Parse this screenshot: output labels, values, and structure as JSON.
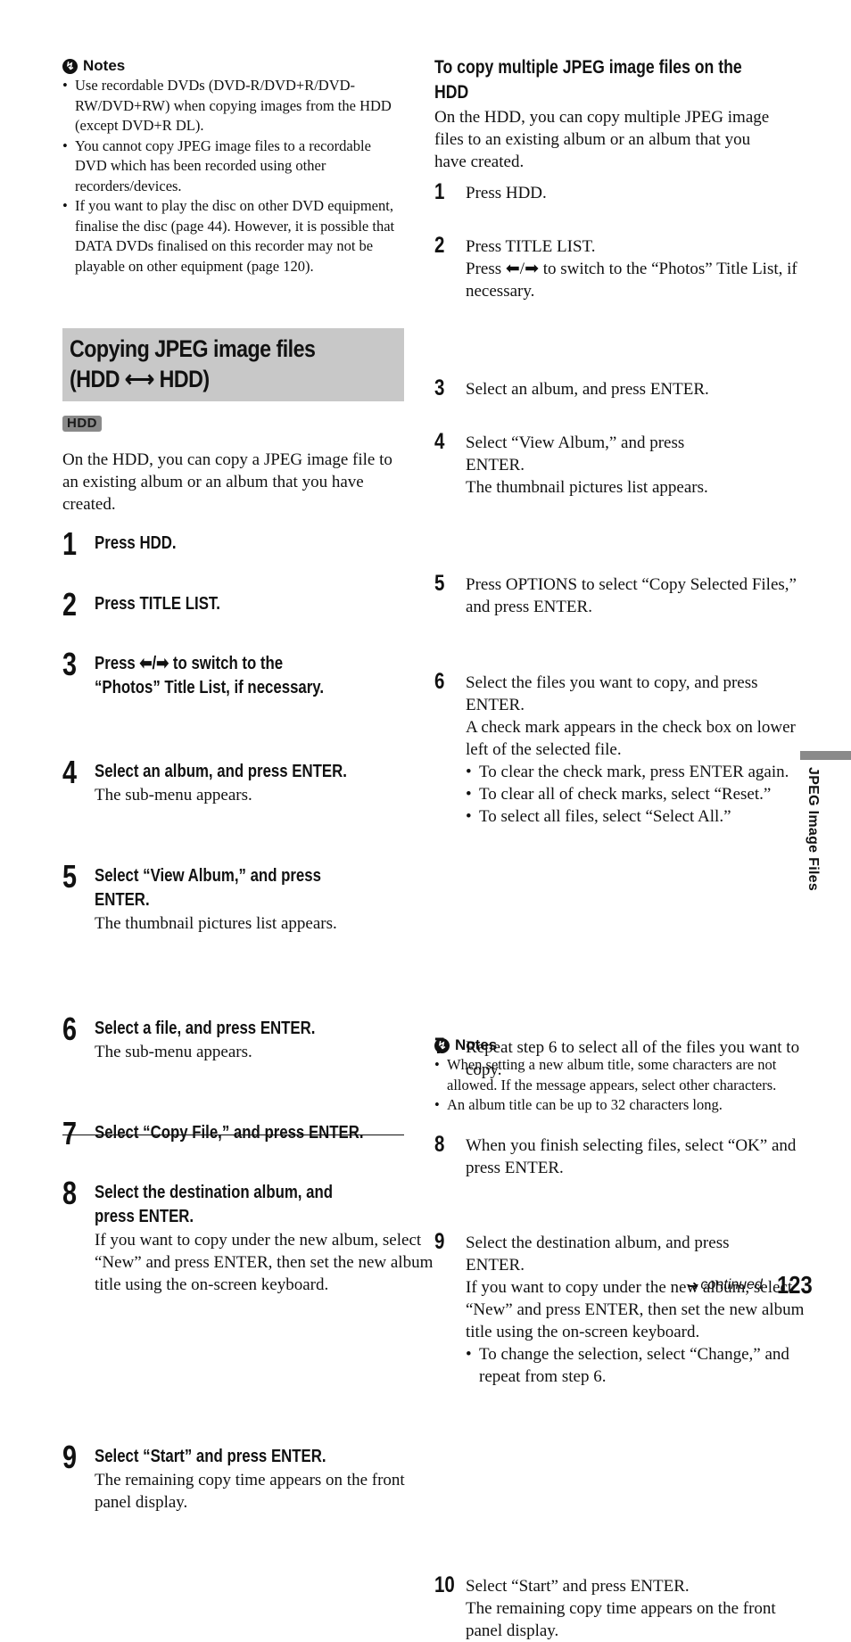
{
  "left": {
    "notes": {
      "heading": "Notes",
      "items": [
        "Use recordable DVDs (DVD-R/DVD+R/DVD-RW/DVD+RW) when copying images from the HDD (except DVD+R DL).",
        "You cannot copy JPEG image files to a recordable DVD which has been recorded using other recorders/devices.",
        "If you want to play the disc on other DVD equipment, finalise the disc (page 44). However, it is possible that DATA DVDs finalised on this recorder may not be playable on other equipment (page 120)."
      ]
    },
    "section_title_line1": "Copying JPEG image files",
    "section_title_line2": "(HDD ⟷ HDD)",
    "badge": "HDD",
    "intro": "On the HDD, you can copy a JPEG image file to an existing album or an album that you have created.",
    "steps": [
      {
        "num": "1",
        "title": "Press HDD.",
        "sub": ""
      },
      {
        "num": "2",
        "title": "Press TITLE LIST.",
        "sub": ""
      },
      {
        "num": "3",
        "title": "Press ⬅/➡ to switch to the",
        "title2": "“Photos” Title List, if necessary.",
        "sub": ""
      },
      {
        "num": "4",
        "title": "Select an album, and press ENTER.",
        "sub": "The sub-menu appears."
      },
      {
        "num": "5",
        "title": "Select “View Album,” and press",
        "title2": "ENTER.",
        "sub": "The thumbnail pictures list appears."
      },
      {
        "num": "6",
        "title": "Select a file, and press ENTER.",
        "sub": "The sub-menu appears."
      },
      {
        "num": "7",
        "title": "Select “Copy File,” and press ENTER.",
        "sub": ""
      },
      {
        "num": "8",
        "title": "Select the destination album, and",
        "title2": "press ENTER.",
        "sub": "If you want to copy under the new album, select “New” and press ENTER, then set the new album title using the on-screen keyboard."
      },
      {
        "num": "9",
        "title": "Select “Start” and press ENTER.",
        "sub": "The remaining copy time appears on the front panel display."
      }
    ]
  },
  "right": {
    "heading_line1": "To copy multiple JPEG image files on the",
    "heading_line2": "HDD",
    "intro": "On the HDD, you can copy multiple JPEG image files to an existing album or an album that you have created.",
    "steps": [
      {
        "num": "1",
        "text": "Press HDD."
      },
      {
        "num": "2",
        "text": "Press TITLE LIST.",
        "text2": "Press ⬅/➡ to switch to the “Photos” Title List, if necessary."
      },
      {
        "num": "3",
        "text": "Select an album, and press ENTER."
      },
      {
        "num": "4",
        "text": "Select “View Album,” and press ENTER.",
        "text2": "The thumbnail pictures list appears."
      },
      {
        "num": "5",
        "text": "Press OPTIONS to select “Copy Selected Files,” and press ENTER."
      },
      {
        "num": "6",
        "text": "Select the files you want to copy, and press ENTER.",
        "text2": "A check mark appears in the check box on lower left of the selected file.",
        "bullets": [
          "To clear the check mark, press ENTER again.",
          "To clear all of check marks, select “Reset.”",
          "To select all files, select “Select All.”"
        ]
      },
      {
        "num": "7",
        "text": "Repeat step 6 to select all of the files you want to copy."
      },
      {
        "num": "8",
        "text": "When you finish selecting files, select “OK” and press ENTER."
      },
      {
        "num": "9",
        "text": "Select the destination album, and press ENTER.",
        "text2": "If you want to copy under the new album, select “New” and press ENTER, then set the new album title using the on-screen keyboard.",
        "bullets": [
          "To change the selection, select “Change,” and repeat from step 6."
        ]
      },
      {
        "num": "10",
        "text": "Select “Start” and press ENTER.",
        "text2": "The remaining copy time appears on the front panel display."
      }
    ],
    "notes": {
      "heading": "Notes",
      "items": [
        "When setting a new album title, some characters are not allowed. If the message appears, select other characters.",
        "An album title can be up to 32 characters long."
      ]
    }
  },
  "side_tab_label": "JPEG Image Files",
  "footer": {
    "arrow": "➜",
    "continued": "continued",
    "page_number": "123"
  }
}
